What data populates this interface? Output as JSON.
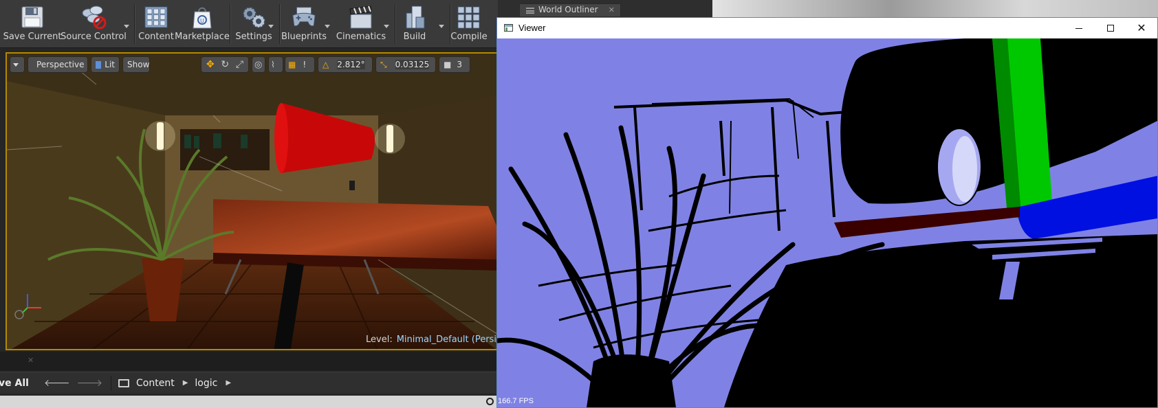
{
  "toolbar": {
    "buttons": [
      {
        "label": "Save Current",
        "icon": "floppy-disk-icon"
      },
      {
        "label": "Source Control",
        "icon": "source-control-icon"
      },
      {
        "label": "Content",
        "icon": "content-grid-icon"
      },
      {
        "label": "Marketplace",
        "icon": "marketplace-bag-icon"
      },
      {
        "label": "Settings",
        "icon": "gears-icon"
      },
      {
        "label": "Blueprints",
        "icon": "gamepad-icon"
      },
      {
        "label": "Cinematics",
        "icon": "clapperboard-icon"
      },
      {
        "label": "Build",
        "icon": "build-blocks-icon"
      },
      {
        "label": "Compile",
        "icon": "compile-cubes-icon"
      }
    ]
  },
  "world_outliner": {
    "tab_label": "World Outliner"
  },
  "viewport": {
    "view_mode": "Perspective",
    "lighting": "Lit",
    "show_label": "Show",
    "rotation_snap": "2.812°",
    "scale_snap": "0.03125",
    "camera_speed": "3",
    "level_label": "Level:",
    "level_name": "Minimal_Default (Persister"
  },
  "content_browser": {
    "save_all": "ve All",
    "breadcrumbs": [
      "Content",
      "logic"
    ]
  },
  "viewer": {
    "title": "Viewer",
    "fps": "166.7 FPS"
  },
  "colors": {
    "viewport_border": "#b38a00",
    "viewer_background": "#7f82e4",
    "cylinder_green": "#00c800",
    "cylinder_blue": "#0010e0"
  }
}
